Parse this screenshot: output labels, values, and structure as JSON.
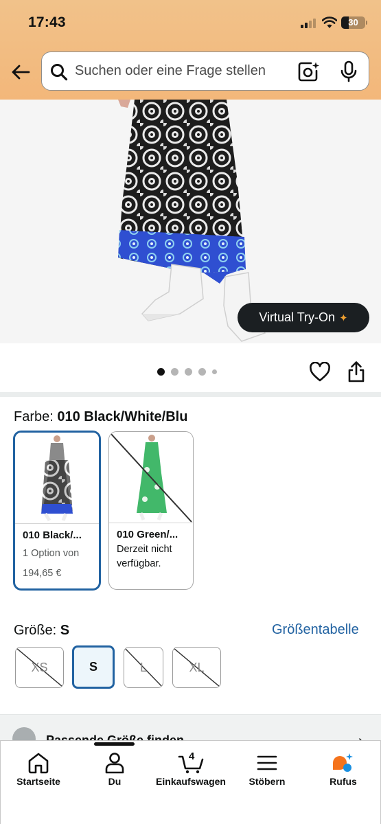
{
  "status_bar": {
    "time": "17:43",
    "battery": "30"
  },
  "search": {
    "placeholder": "Suchen oder eine Frage stellen"
  },
  "product": {
    "try_on_label": "Virtual Try-On",
    "image_count": 5,
    "active_image": 1
  },
  "color": {
    "label": "Farbe: ",
    "selected": "010 Black/White/Blu",
    "swatches": [
      {
        "name": "010 Black/...",
        "options": "1 Option von",
        "price": "194,65 €",
        "available": true
      },
      {
        "name": "010 Green/...",
        "availability": "Derzeit nicht verfügbar.",
        "available": false
      }
    ]
  },
  "size": {
    "label": "Größe: ",
    "selected": "S",
    "chart_link": "Größentabelle",
    "options": [
      {
        "label": "XS",
        "available": false
      },
      {
        "label": "S",
        "available": true
      },
      {
        "label": "L",
        "available": false
      },
      {
        "label": "XL",
        "available": false
      }
    ]
  },
  "find_size": {
    "label": "Passende Größe finden"
  },
  "nav": {
    "items": [
      {
        "label": "Startseite",
        "icon": "home-icon"
      },
      {
        "label": "Du",
        "icon": "person-icon"
      },
      {
        "label": "Einkaufswagen",
        "icon": "cart-icon",
        "count": "4"
      },
      {
        "label": "Stöbern",
        "icon": "menu-icon"
      },
      {
        "label": "Rufus",
        "icon": "rufus-icon"
      }
    ]
  },
  "colors": {
    "header": "#f3b77a",
    "accent_blue": "#2162a1",
    "rufus_orange": "#f5731c",
    "rufus_blue": "#1a8fe0"
  }
}
